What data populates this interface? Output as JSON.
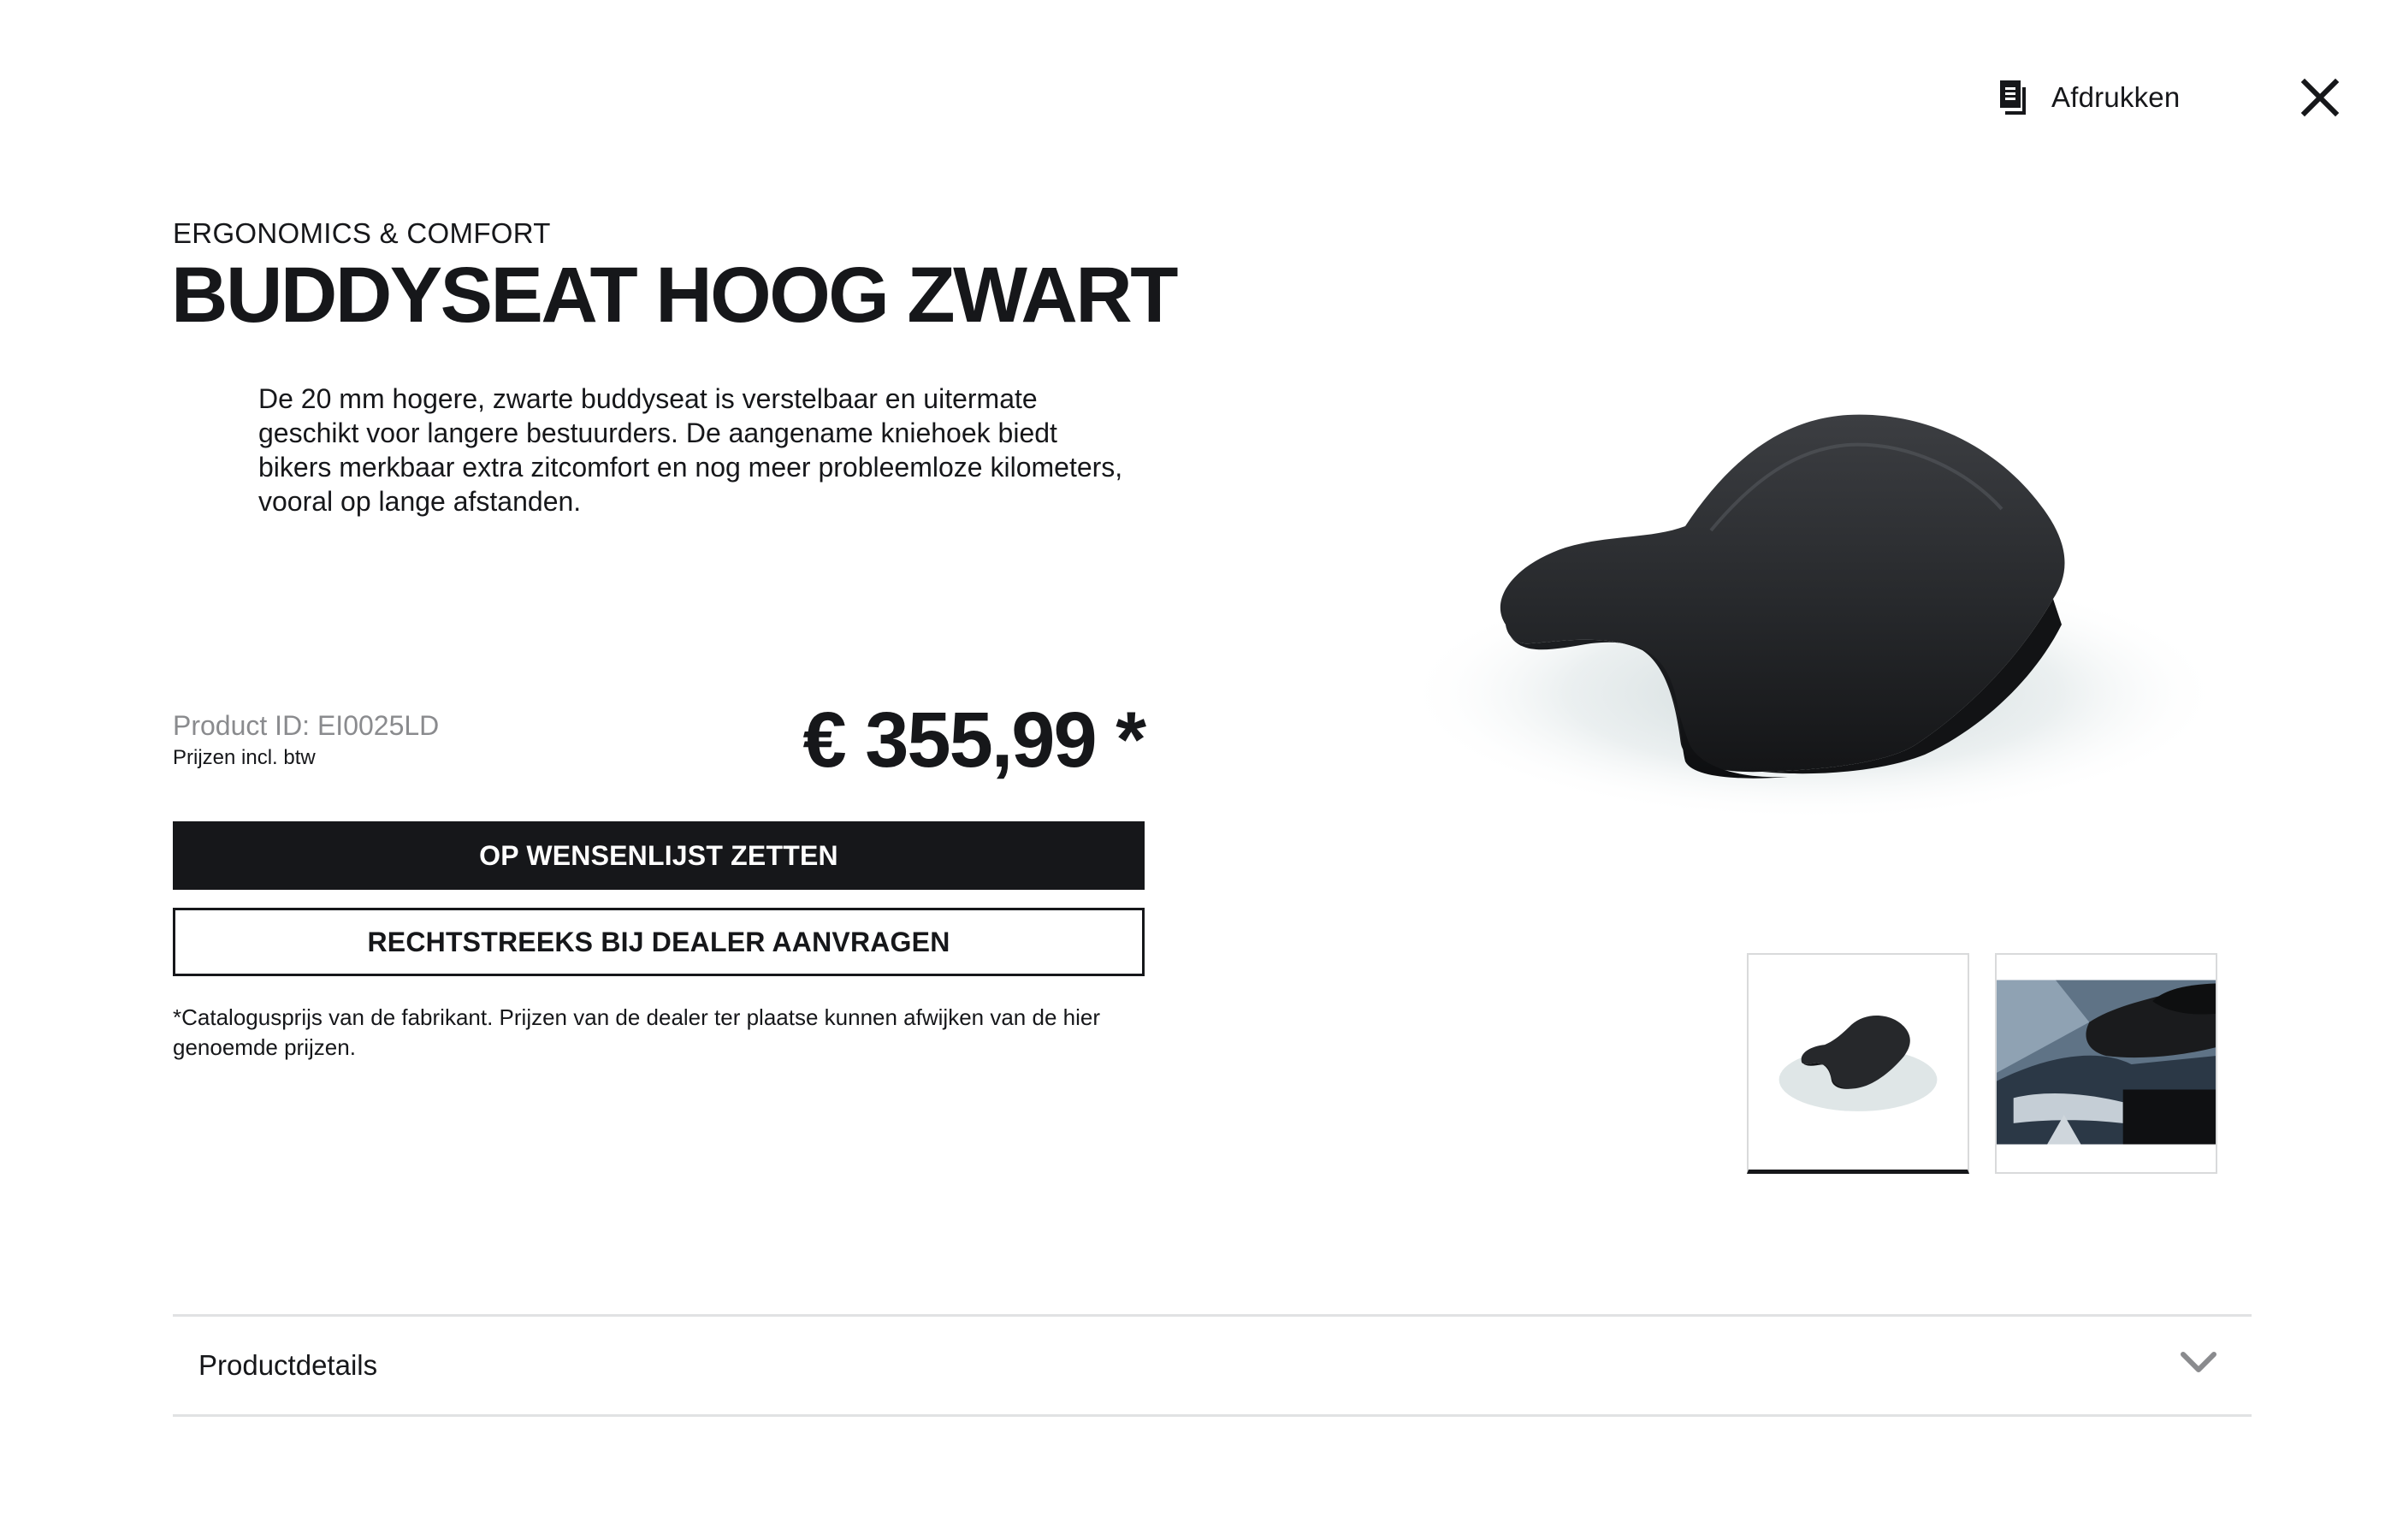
{
  "toolbar": {
    "print_label": "Afdrukken",
    "print_icon": "print-document-icon",
    "close_icon": "close-icon"
  },
  "product": {
    "category": "ERGONOMICS & COMFORT",
    "title": "BUDDYSEAT HOOG ZWART",
    "description": "De 20 mm hogere, zwarte buddyseat is verstelbaar en uitermate geschikt voor langere bestuurders. De aangename kniehoek biedt bikers merkbaar extra zitcomfort en nog meer probleemloze kilometers, vooral op lange afstanden.",
    "product_id": "Product ID: EI0025LD",
    "vat_note": "Prijzen incl. btw",
    "price": "€ 355,99 *"
  },
  "actions": {
    "wishlist_label": "OP WENSENLIJST ZETTEN",
    "dealer_label": "RECHTSTREEKS BIJ DEALER AANVRAGEN"
  },
  "disclaimer": "*Catalogusprijs van de fabrikant. Prijzen van de dealer ter plaatse kunnen afwijken van de hier genoemde prijzen.",
  "gallery": {
    "selected_index": 0,
    "thumbnails": [
      "seat-product-thumbnail",
      "seat-mounted-on-motorcycle-thumbnail"
    ]
  },
  "accordion": {
    "label": "Productdetails",
    "expanded": false
  },
  "colors": {
    "text": "#16171a",
    "muted": "#8a8b8e",
    "border": "#e1e2e3",
    "primary_button": "#16171a"
  }
}
